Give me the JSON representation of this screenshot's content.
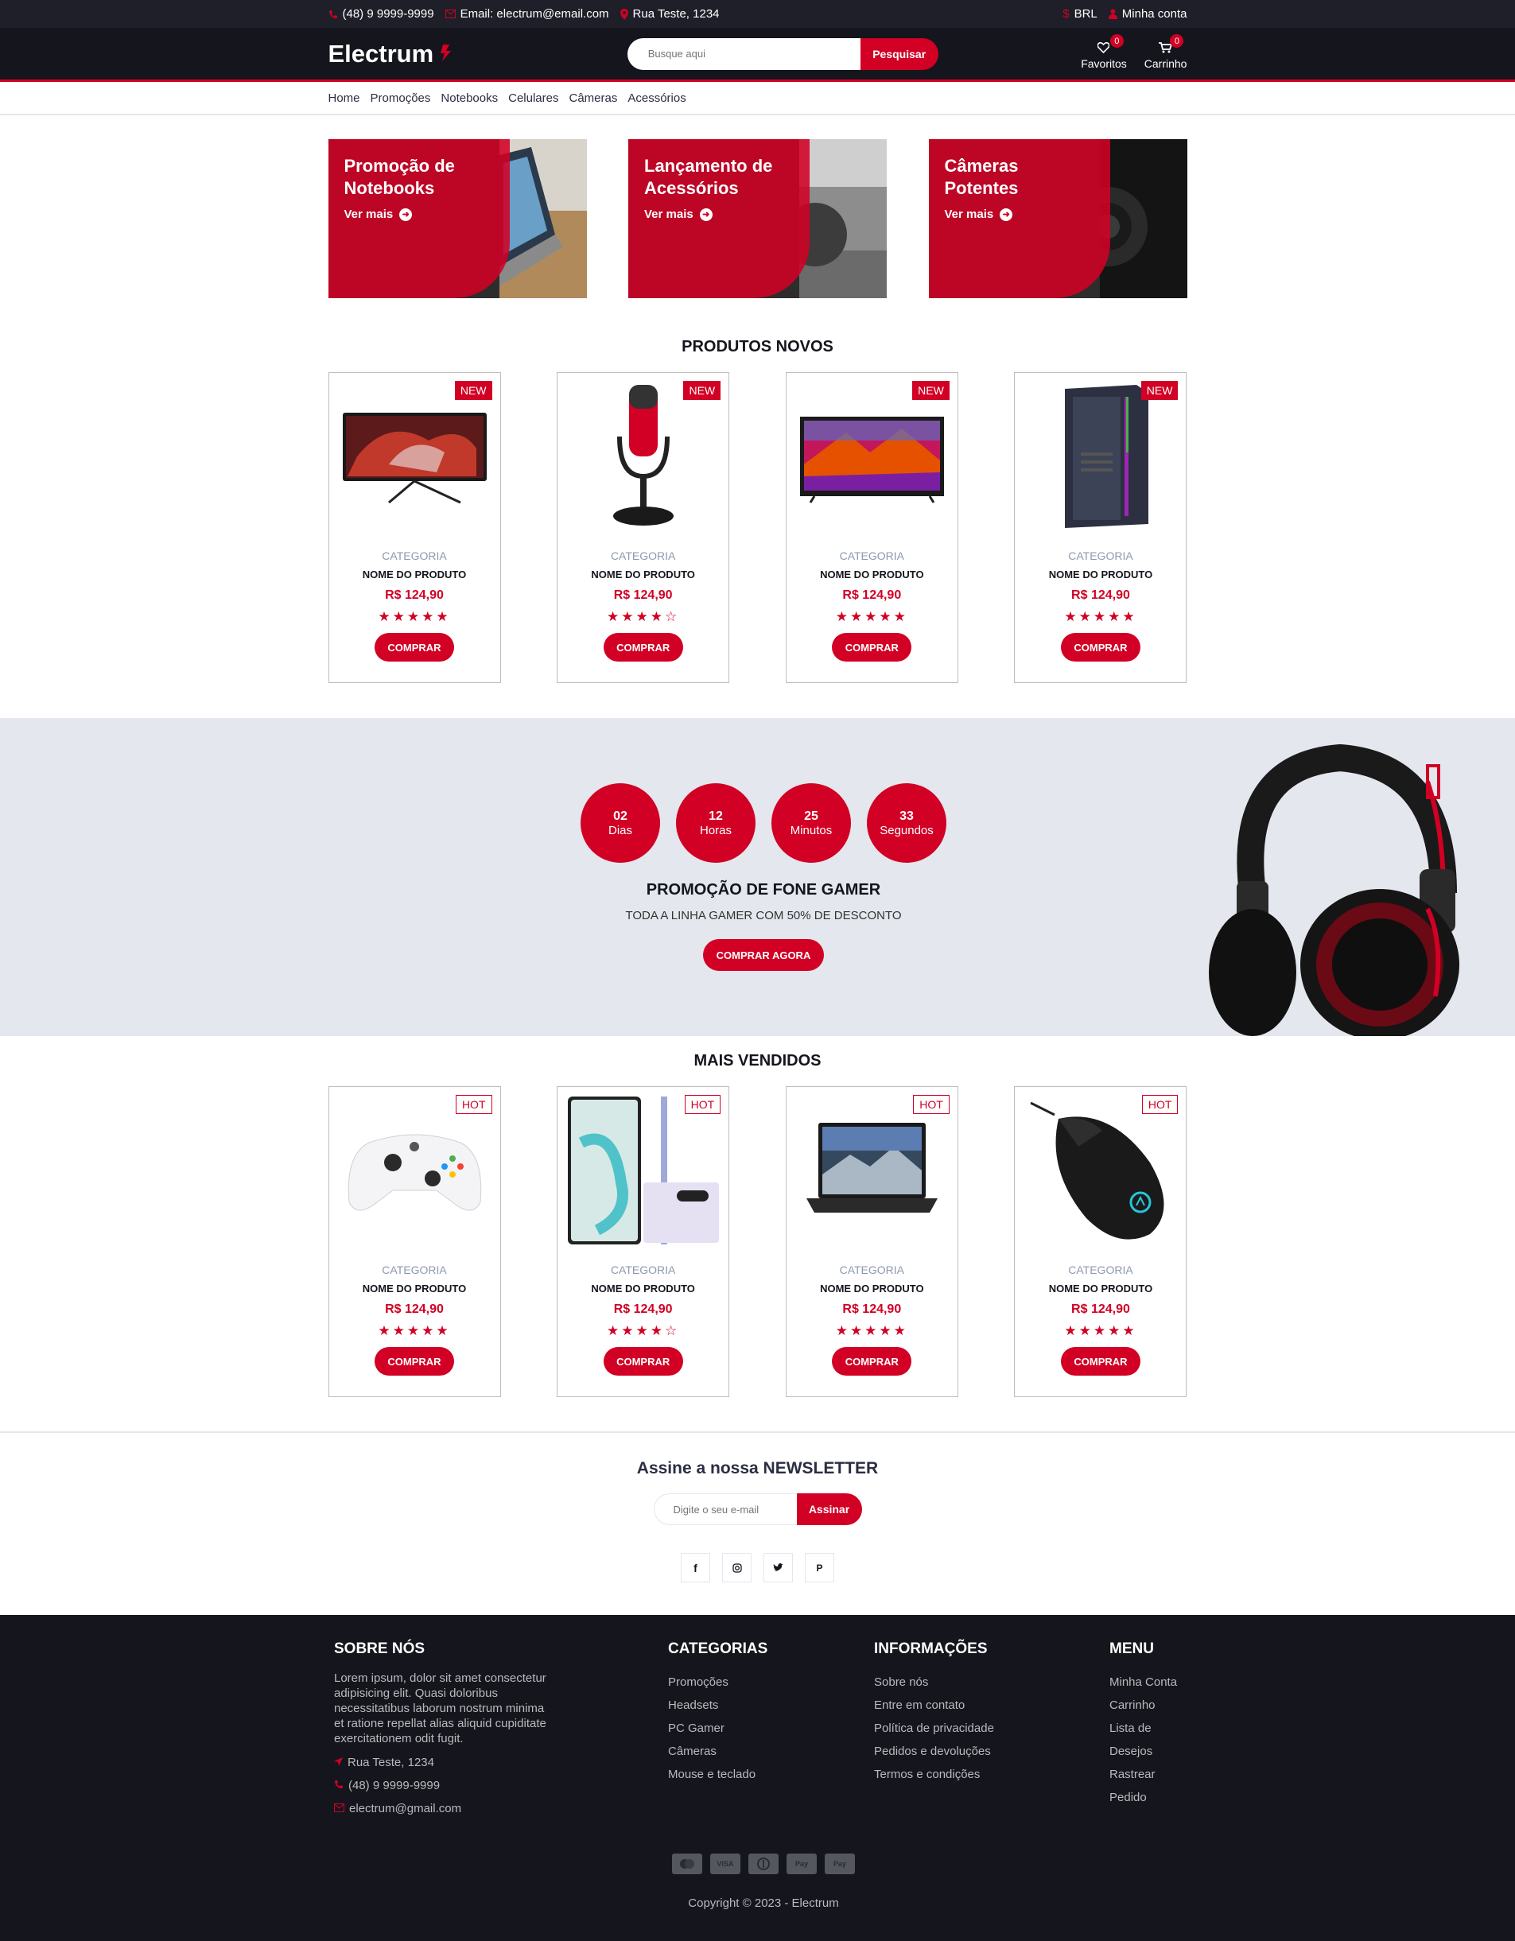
{
  "topbar": {
    "phone": "(48) 9 9999-9999",
    "email": "Email: electrum@email.com",
    "address": "Rua Teste, 1234",
    "currency": "BRL",
    "account": "Minha conta"
  },
  "header": {
    "logo": "Electrum",
    "search_placeholder": "Busque aqui",
    "search_button": "Pesquisar",
    "favorites_label": "Favoritos",
    "favorites_count": "0",
    "cart_label": "Carrinho",
    "cart_count": "0"
  },
  "nav": [
    "Home",
    "Promoções",
    "Notebooks",
    "Celulares",
    "Câmeras",
    "Acessórios"
  ],
  "banners": [
    {
      "title": "Promoção de Notebooks",
      "link": "Ver mais"
    },
    {
      "title": "Lançamento de Acessórios",
      "link": "Ver mais"
    },
    {
      "title": "Câmeras Potentes",
      "link": "Ver mais"
    }
  ],
  "new_products": {
    "title": "PRODUTOS NOVOS",
    "items": [
      {
        "tag": "NEW",
        "category": "CATEGORIA",
        "name": "NOME DO PRODUTO",
        "price": "R$ 124,90",
        "rating": 5,
        "button": "COMPRAR",
        "image": "monitor-icon"
      },
      {
        "tag": "NEW",
        "category": "CATEGORIA",
        "name": "NOME DO PRODUTO",
        "price": "R$ 124,90",
        "rating": 4,
        "button": "COMPRAR",
        "image": "microphone-icon"
      },
      {
        "tag": "NEW",
        "category": "CATEGORIA",
        "name": "NOME DO PRODUTO",
        "price": "R$ 124,90",
        "rating": 5,
        "button": "COMPRAR",
        "image": "tv-icon"
      },
      {
        "tag": "NEW",
        "category": "CATEGORIA",
        "name": "NOME DO PRODUTO",
        "price": "R$ 124,90",
        "rating": 5,
        "button": "COMPRAR",
        "image": "pc-case-icon"
      }
    ]
  },
  "deal": {
    "countdown": [
      {
        "value": "02",
        "unit": "Dias"
      },
      {
        "value": "12",
        "unit": "Horas"
      },
      {
        "value": "25",
        "unit": "Minutos"
      },
      {
        "value": "33",
        "unit": "Segundos"
      }
    ],
    "title": "PROMOÇÃO DE FONE GAMER",
    "subtitle": "TODA A LINHA GAMER COM 50% DE DESCONTO",
    "button": "COMPRAR AGORA"
  },
  "best_sellers": {
    "title": "MAIS VENDIDOS",
    "items": [
      {
        "tag": "HOT",
        "category": "CATEGORIA",
        "name": "NOME DO PRODUTO",
        "price": "R$ 124,90",
        "rating": 5,
        "button": "COMPRAR",
        "image": "controller-icon"
      },
      {
        "tag": "HOT",
        "category": "CATEGORIA",
        "name": "NOME DO PRODUTO",
        "price": "R$ 124,90",
        "rating": 4,
        "button": "COMPRAR",
        "image": "smartphone-icon"
      },
      {
        "tag": "HOT",
        "category": "CATEGORIA",
        "name": "NOME DO PRODUTO",
        "price": "R$ 124,90",
        "rating": 5,
        "button": "COMPRAR",
        "image": "laptop-icon"
      },
      {
        "tag": "HOT",
        "category": "CATEGORIA",
        "name": "NOME DO PRODUTO",
        "price": "R$ 124,90",
        "rating": 5,
        "button": "COMPRAR",
        "image": "mouse-icon"
      }
    ]
  },
  "newsletter": {
    "title_prefix": "Assine a nossa ",
    "title_strong": "NEWSLETTER",
    "placeholder": "Digite o seu e-mail",
    "button": "Assinar",
    "social": [
      "facebook-icon",
      "instagram-icon",
      "twitter-icon",
      "pinterest-icon"
    ]
  },
  "footer": {
    "about": {
      "title": "SOBRE NÓS",
      "text": "Lorem ipsum, dolor sit amet consectetur adipisicing elit. Quasi doloribus necessitatibus laborum nostrum minima et ratione repellat alias aliquid cupiditate exercitationem odit fugit.",
      "address": "Rua Teste, 1234",
      "phone": "(48) 9 9999-9999",
      "email": "electrum@gmail.com"
    },
    "categories": {
      "title": "CATEGORIAS",
      "links": [
        "Promoções",
        "Headsets",
        "PC Gamer",
        "Câmeras",
        "Mouse e teclado"
      ]
    },
    "info": {
      "title": "INFORMAÇÕES",
      "links": [
        "Sobre nós",
        "Entre em contato",
        "Política de privacidade",
        "Pedidos e devoluções",
        "Termos e condições"
      ]
    },
    "menu": {
      "title": "MENU",
      "links": [
        "Minha Conta",
        "Carrinho",
        "Lista de Desejos",
        "Rastrear Pedido"
      ]
    },
    "payments": [
      "mastercard-icon",
      "visa-icon",
      "diners-icon",
      "paypal-icon",
      "applepay-icon"
    ],
    "copyright": "Copyright © 2023 - Electrum"
  },
  "colors": {
    "accent": "#d10024",
    "dark": "#15161d",
    "topbar": "#1e1f29",
    "deal_bg": "#e4e7ed"
  }
}
